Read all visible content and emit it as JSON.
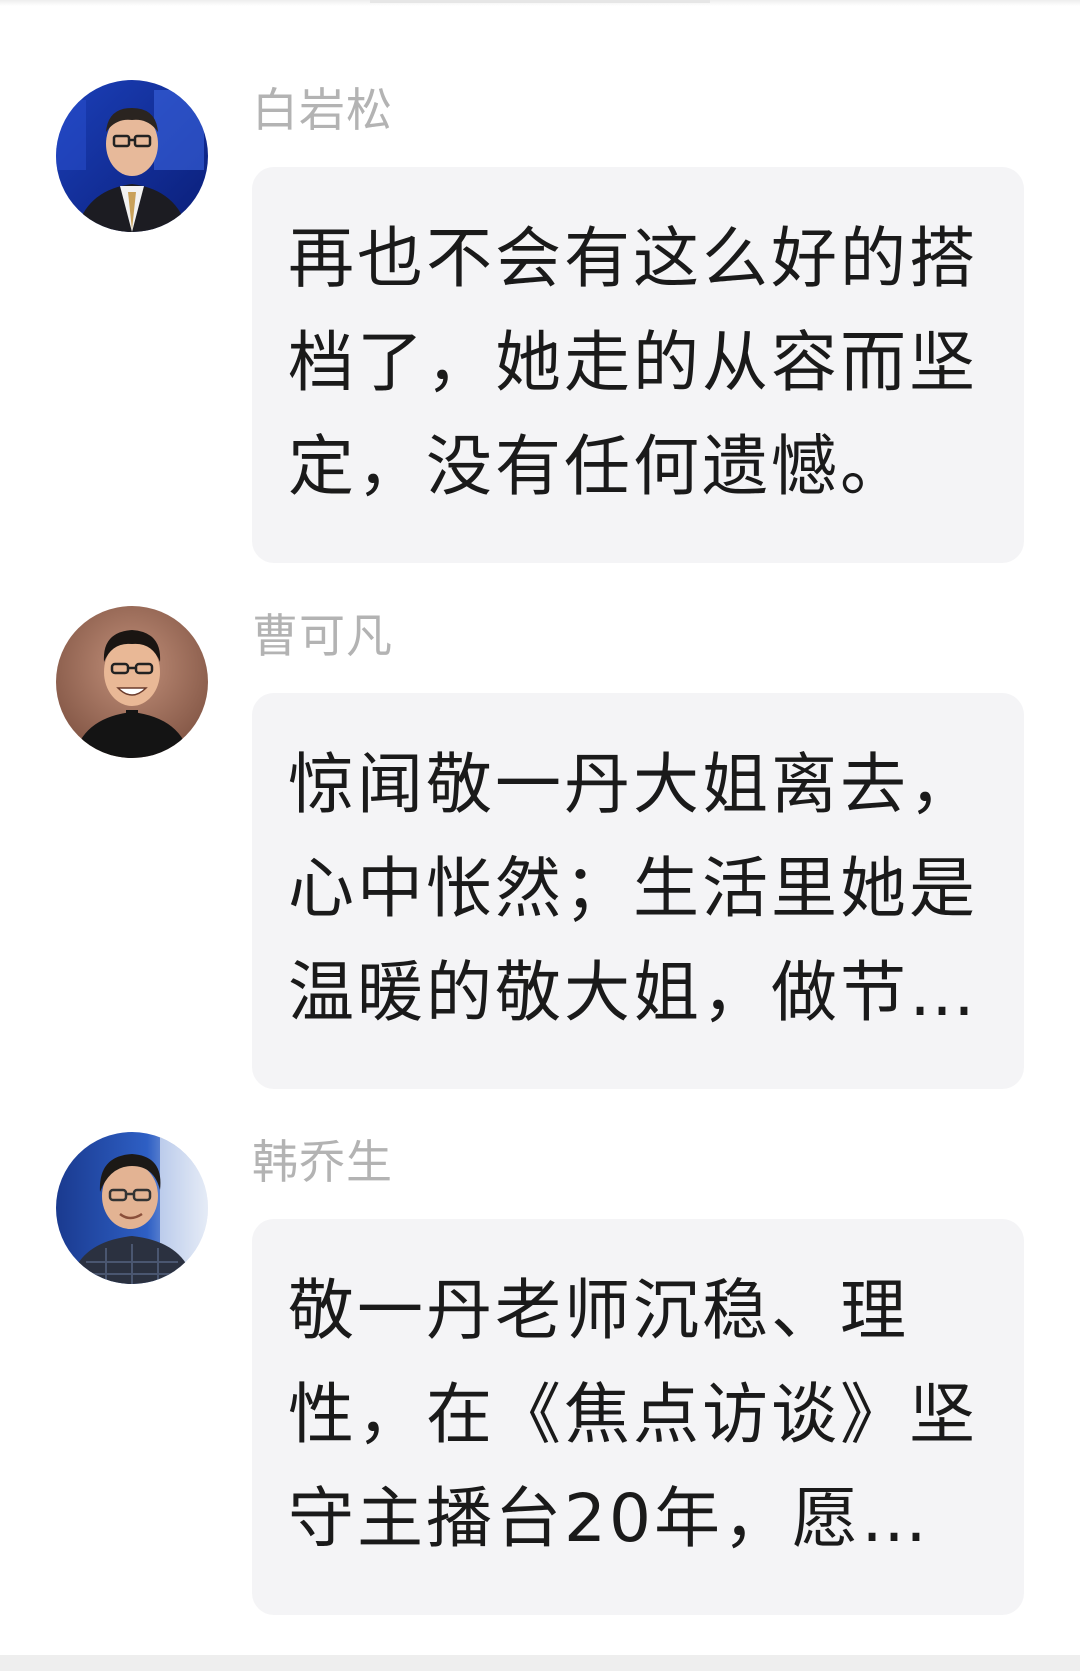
{
  "comments": [
    {
      "name": "白岩松",
      "text": "再也不会有这么好的搭档了，她走的从容而坚定，没有任何遗憾。"
    },
    {
      "name": "曹可凡",
      "text": "惊闻敬一丹大姐离去，心中怅然；生活里她是温暖的敬大姐，做节…"
    },
    {
      "name": "韩乔生",
      "text": "敬一丹老师沉稳、理性，在《焦点访谈》坚守主播台20年，愿…"
    }
  ],
  "colors": {
    "name": "#b3b3b3",
    "bubble_bg": "#f4f4f6",
    "text": "#1a1a1a"
  }
}
